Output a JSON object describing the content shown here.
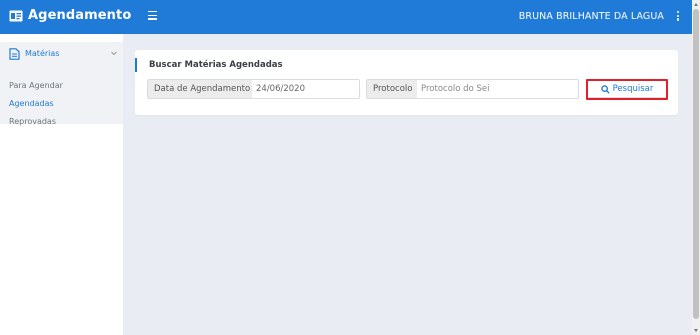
{
  "header": {
    "brand": "Agendamento",
    "user_name": "BRUNA BRILHANTE DA LAGUA"
  },
  "sidebar": {
    "section_label": "Matérias",
    "items": [
      {
        "label": "Para Agendar",
        "active": false
      },
      {
        "label": "Agendadas",
        "active": true
      },
      {
        "label": "Reprovadas",
        "active": false
      }
    ]
  },
  "search": {
    "title": "Buscar Matérias Agendadas",
    "date_label": "Data de Agendamento",
    "date_value": "24/06/2020",
    "protocol_label": "Protocolo",
    "protocol_placeholder": "Protocolo do Sei",
    "button_label": "Pesquisar"
  },
  "colors": {
    "primary": "#1f7ad8",
    "highlight": "#e0202a",
    "background": "#e9edf3"
  }
}
